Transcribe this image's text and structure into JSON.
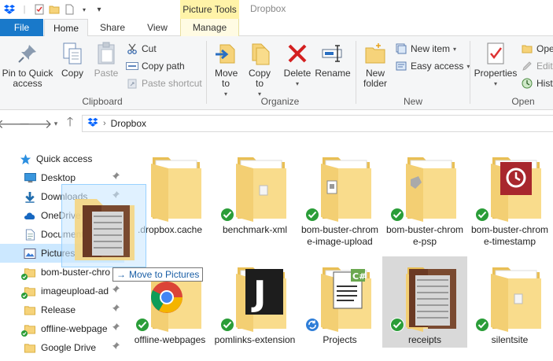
{
  "titlebar": {
    "context_tab": "Picture Tools",
    "app_title": "Dropbox"
  },
  "tabs": {
    "file": "File",
    "home": "Home",
    "share": "Share",
    "view": "View",
    "manage": "Manage"
  },
  "ribbon": {
    "clipboard": {
      "label": "Clipboard",
      "pin": "Pin to Quick access",
      "copy": "Copy",
      "paste": "Paste",
      "cut": "Cut",
      "copy_path": "Copy path",
      "paste_shortcut": "Paste shortcut"
    },
    "organize": {
      "label": "Organize",
      "move_to": "Move to",
      "copy_to": "Copy to",
      "delete": "Delete",
      "rename": "Rename"
    },
    "new": {
      "label": "New",
      "new_folder": "New folder",
      "new_item": "New item",
      "easy_access": "Easy access"
    },
    "open": {
      "label": "Open",
      "properties": "Properties",
      "open": "Ope",
      "edit": "Edit",
      "history": "Histo"
    }
  },
  "address": {
    "path": "Dropbox"
  },
  "navpane": {
    "quick_access": "Quick access",
    "items": [
      {
        "label": "Desktop",
        "pinned": true
      },
      {
        "label": "Downloads",
        "pinned": true
      },
      {
        "label": "OneDrive for Bus",
        "pinned": true
      },
      {
        "label": "Documents",
        "pinned": true
      },
      {
        "label": "Pictures",
        "pinned": false
      },
      {
        "label": "bom-buster-chro",
        "pinned": false
      },
      {
        "label": "imageupload-ad",
        "pinned": true
      },
      {
        "label": "Release",
        "pinned": true
      },
      {
        "label": "offline-webpage",
        "pinned": true
      },
      {
        "label": "Google Drive",
        "pinned": true
      }
    ]
  },
  "drag": {
    "tooltip": "Move to Pictures"
  },
  "files": [
    {
      "name": ".dropbox.cache",
      "status": "none"
    },
    {
      "name": "benchmark-xml",
      "status": "synced"
    },
    {
      "name": "bom-buster-chrome-image-upload",
      "status": "synced"
    },
    {
      "name": "bom-buster-chrome-psp",
      "status": "synced"
    },
    {
      "name": "bom-buster-chrome-timestamp",
      "status": "synced"
    },
    {
      "name": "offline-webpages",
      "status": "synced"
    },
    {
      "name": "pomlinks-extension",
      "status": "synced"
    },
    {
      "name": "Projects",
      "status": "syncing"
    },
    {
      "name": "receipts",
      "status": "synced"
    },
    {
      "name": "silentsite",
      "status": "synced"
    }
  ],
  "colors": {
    "accent": "#1979ca",
    "picture_tools": "#fff3a8",
    "selection": "#cce8ff",
    "synced_green": "#2a9d38",
    "syncing_blue": "#2f7ed8",
    "folder_yellow": "#f6d37a"
  }
}
